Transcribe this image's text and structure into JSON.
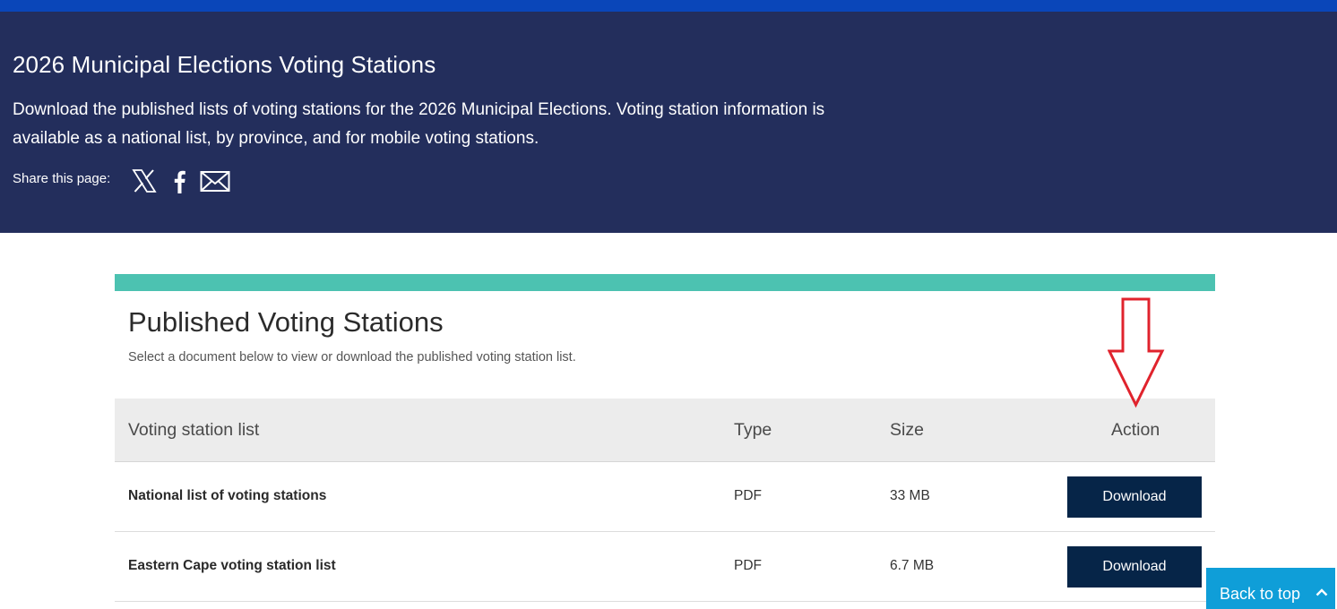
{
  "hero": {
    "title": "2026 Municipal Elections Voting Stations",
    "description": "Download the published lists of voting stations for the 2026 Municipal Elections. Voting station information is available as a national list, by province, and for mobile voting stations.",
    "share_label": "Share this page:",
    "share_icons": [
      "x-icon",
      "facebook-icon",
      "mail-icon"
    ]
  },
  "card": {
    "title": "Published Voting Stations",
    "subtitle": "Select a document below to view or download the published voting station list."
  },
  "table": {
    "headers": [
      "Voting station list",
      "Type",
      "Size",
      "Action"
    ],
    "rows": [
      {
        "name": "National list of voting stations",
        "type": "PDF",
        "size": "33 MB",
        "action": "Download"
      },
      {
        "name": "Eastern Cape voting station list",
        "type": "PDF",
        "size": "6.7 MB",
        "action": "Download"
      }
    ]
  },
  "back_to_top": {
    "label": "Back to top",
    "icon": "chevron-up-icon"
  },
  "colors": {
    "topbar": "#0a46b9",
    "hero_bg": "#232e5c",
    "accent_bar": "#4cc2b1",
    "button_bg": "#062548",
    "back_to_top_bg": "#0f9ed8",
    "annotation_arrow": "#e0232d"
  }
}
